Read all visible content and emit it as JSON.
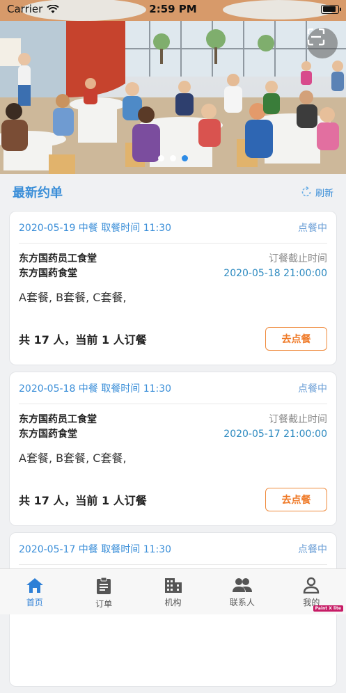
{
  "status_bar": {
    "carrier": "Carrier",
    "time": "2:59 PM"
  },
  "banner": {
    "total_slides": 3,
    "active_slide": 3
  },
  "section": {
    "title": "最新约单",
    "refresh_label": "刷新"
  },
  "cards": [
    {
      "date_line": "2020-05-19 中餐 取餐时间 11:30",
      "state": "点餐中",
      "canteen_1": "东方国药员工食堂",
      "canteen_2": "东方国药食堂",
      "deadline_label": "订餐截止时间",
      "deadline_value": "2020-05-18 21:00:00",
      "meals": "A套餐, B套餐, C套餐,",
      "count_text": "共 17 人，当前 1 人订餐",
      "button": "去点餐"
    },
    {
      "date_line": "2020-05-18 中餐 取餐时间 11:30",
      "state": "点餐中",
      "canteen_1": "东方国药员工食堂",
      "canteen_2": "东方国药食堂",
      "deadline_label": "订餐截止时间",
      "deadline_value": "2020-05-17 21:00:00",
      "meals": "A套餐, B套餐, C套餐,",
      "count_text": "共 17 人，当前 1 人订餐",
      "button": "去点餐"
    },
    {
      "date_line": "2020-05-17 中餐 取餐时间 11:30",
      "state": "点餐中"
    }
  ],
  "tabs": [
    {
      "label": "首页",
      "icon": "home-icon",
      "active": true
    },
    {
      "label": "订单",
      "icon": "clipboard-icon",
      "active": false
    },
    {
      "label": "机构",
      "icon": "building-icon",
      "active": false
    },
    {
      "label": "联系人",
      "icon": "people-icon",
      "active": false
    },
    {
      "label": "我的",
      "icon": "person-icon",
      "active": false
    }
  ],
  "corner_badge": "Paint X lite",
  "colors": {
    "accent": "#3a8ed8",
    "order_button": "#ef7a28",
    "active_tab": "#2d7fd6"
  }
}
